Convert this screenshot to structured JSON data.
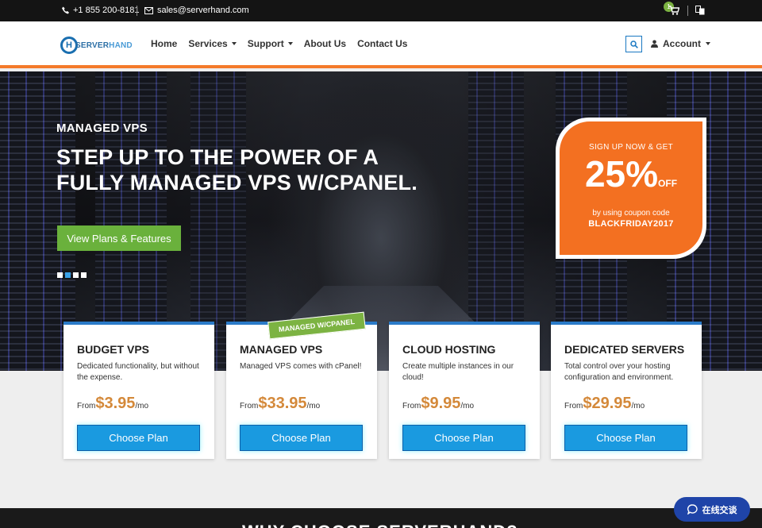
{
  "topbar": {
    "phone": "+1 855 200-8181",
    "email": "sales@serverhand.com",
    "cart_count": "1"
  },
  "brand": {
    "logo_letter": "H",
    "name_a": "SERVER",
    "name_b": "HAND"
  },
  "nav": {
    "items": [
      "Home",
      "Services",
      "Support",
      "About Us",
      "Contact Us"
    ],
    "account": "Account"
  },
  "hero": {
    "subtitle": "MANAGED VPS",
    "title": "STEP UP TO THE POWER OF A FULLY MANAGED VPS W/CPANEL.",
    "button": "View Plans & Features",
    "slide_count": 4,
    "active_slide": 1
  },
  "promo": {
    "line1": "SIGN UP NOW & GET",
    "percent": "25%",
    "off": "OFF",
    "line3": "by using coupon code",
    "code": "BLACKFRIDAY2017"
  },
  "plans": [
    {
      "name": "BUDGET VPS",
      "desc": "Dedicated functionality, but without the expense.",
      "from": "From",
      "price": "$3.95",
      "per": "/mo",
      "button": "Choose Plan"
    },
    {
      "name": "MANAGED VPS",
      "desc": "Managed VPS comes with cPanel!",
      "from": "From",
      "price": "$33.95",
      "per": "/mo",
      "button": "Choose Plan"
    },
    {
      "name": "CLOUD HOSTING",
      "desc": "Create multiple instances in our cloud!",
      "from": "From",
      "price": "$9.95",
      "per": "/mo",
      "button": "Choose Plan"
    },
    {
      "name": "DEDICATED SERVERS",
      "desc": "Total control over your hosting configuration and environment.",
      "from": "From",
      "price": "$29.95",
      "per": "/mo",
      "button": "Choose Plan"
    }
  ],
  "ribbon": "MANAGED W/CPANEL",
  "section_heading": "WHY CHOOSE SERVERHAND?",
  "chat": {
    "label": "在线交谈"
  },
  "colors": {
    "accent": "#f47a2a",
    "green": "#6ab13c",
    "blue": "#1a9ae0"
  }
}
